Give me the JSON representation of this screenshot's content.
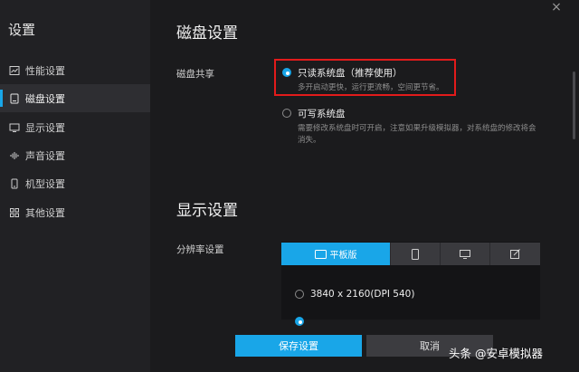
{
  "sidebar": {
    "title": "设置",
    "items": [
      {
        "label": "性能设置",
        "icon": "performance-icon",
        "active": false
      },
      {
        "label": "磁盘设置",
        "icon": "disk-icon",
        "active": true
      },
      {
        "label": "显示设置",
        "icon": "display-icon",
        "active": false
      },
      {
        "label": "声音设置",
        "icon": "sound-icon",
        "active": false
      },
      {
        "label": "机型设置",
        "icon": "phone-icon",
        "active": false
      },
      {
        "label": "其他设置",
        "icon": "grid-icon",
        "active": false
      }
    ]
  },
  "disk": {
    "section_title": "磁盘设置",
    "share_label": "磁盘共享",
    "option1_label": "只读系统盘（推荐使用）",
    "option1_desc": "多开启动更快，运行更流畅，空间更节省。",
    "option2_label": "可写系统盘",
    "option2_desc_line1": "需要修改系统盘时可开启，注意如果升级模拟器，对系统盘的修改将会",
    "option2_desc_line2": "消失。"
  },
  "display": {
    "section_title": "显示设置",
    "resolution_label": "分辨率设置",
    "tabs": [
      {
        "label": "平板版",
        "icon": "tablet-icon",
        "active": true
      },
      {
        "label": "",
        "icon": "phone-portrait-icon",
        "active": false
      },
      {
        "label": "",
        "icon": "monitor-icon",
        "active": false
      },
      {
        "label": "",
        "icon": "edit-icon",
        "active": false
      }
    ],
    "resolution_option": "3840 x 2160(DPI 540)"
  },
  "footer": {
    "save_label": "保存设置",
    "cancel_label": "取消"
  },
  "watermark": "头条 @安卓模拟器",
  "colors": {
    "accent": "#19a6e8",
    "highlight": "#e21b1b"
  }
}
